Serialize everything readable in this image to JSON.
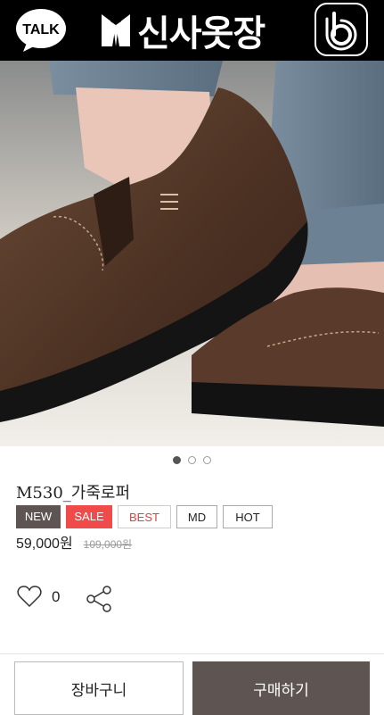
{
  "header": {
    "talk_label": "TALK",
    "logo_text": "신사옷장",
    "colors": {
      "background": "#000000",
      "foreground": "#ffffff"
    },
    "icons": [
      "talk-icon",
      "tuxedo-logo-icon",
      "b-logo-icon"
    ]
  },
  "carousel": {
    "slide_count": 3,
    "active_index": 0
  },
  "product": {
    "title": "M530_가죽로퍼",
    "badges": [
      "NEW",
      "SALE",
      "BEST",
      "MD",
      "HOT"
    ],
    "price": "59,000원",
    "original_price": "109,000원",
    "like_count": "0"
  },
  "footer": {
    "cart_label": "장바구니",
    "buy_label": "구매하기"
  },
  "colors": {
    "accent": "#5e5553",
    "sale": "#f04b4b",
    "best_text": "#e04040"
  }
}
